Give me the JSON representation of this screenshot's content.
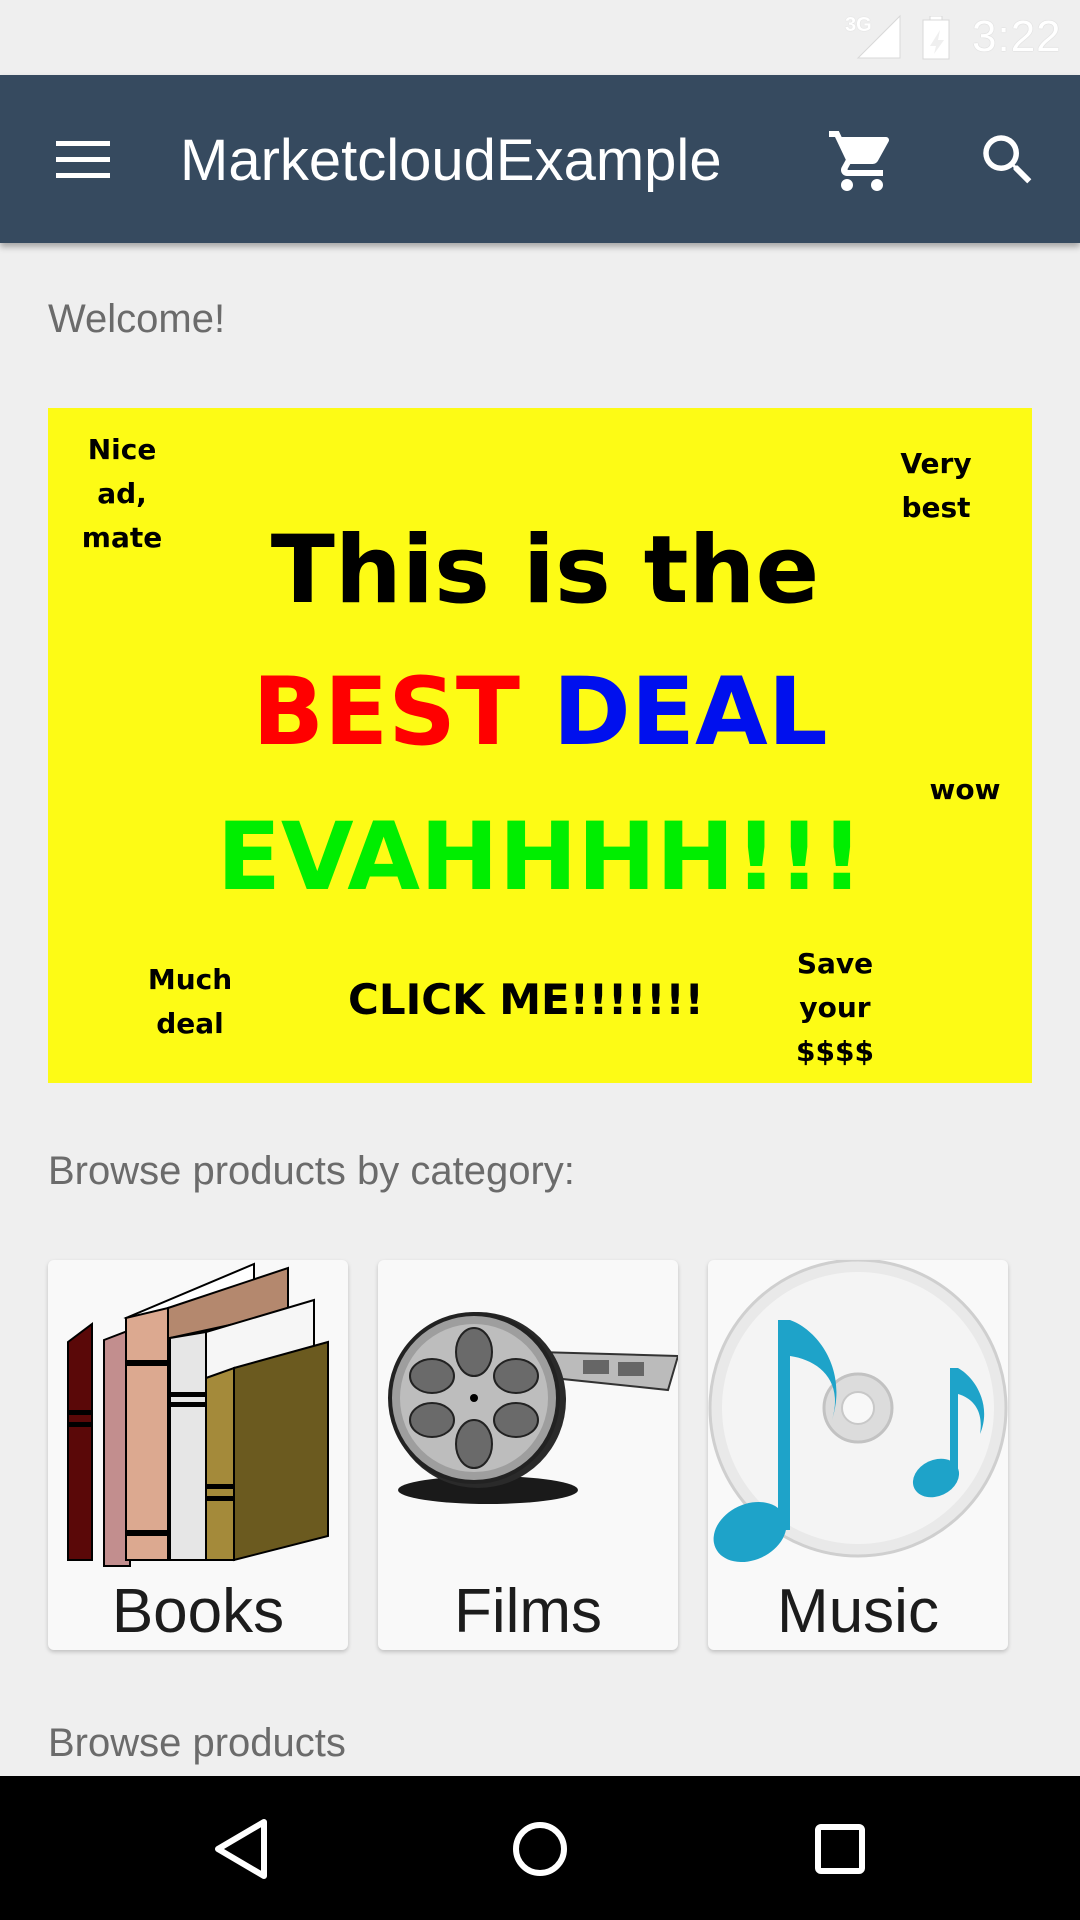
{
  "status_bar": {
    "network": "3G",
    "time": "3:22"
  },
  "app_bar": {
    "title": "MarketcloudExample",
    "menu_icon": "hamburger-menu-icon",
    "cart_icon": "shopping-cart-icon",
    "search_icon": "search-icon",
    "color": "#364a5f"
  },
  "main": {
    "welcome": "Welcome!",
    "banner": {
      "top_left": [
        "Nice",
        "ad,",
        "mate"
      ],
      "top_right": [
        "Very",
        "best"
      ],
      "line1": "This is the",
      "line2_red": "BEST",
      "line2_blue": "DEAL",
      "line3": "EVAHHHH!!!",
      "side": "wow",
      "bottom_left": [
        "Much",
        "deal"
      ],
      "cta": "CLICK ME!!!!!!!",
      "bottom_right": [
        "Save",
        "your",
        "$$$$"
      ],
      "background": "#fdfb15"
    },
    "browse_label": "Browse products by category:",
    "categories": [
      {
        "label": "Books",
        "icon": "books-icon"
      },
      {
        "label": "Films",
        "icon": "film-reel-icon"
      },
      {
        "label": "Music",
        "icon": "music-cd-icon"
      }
    ],
    "cut_off_label": "Browse products"
  },
  "nav_bar": {
    "back_icon": "back-triangle-icon",
    "home_icon": "home-circle-icon",
    "recents_icon": "recents-square-icon"
  }
}
